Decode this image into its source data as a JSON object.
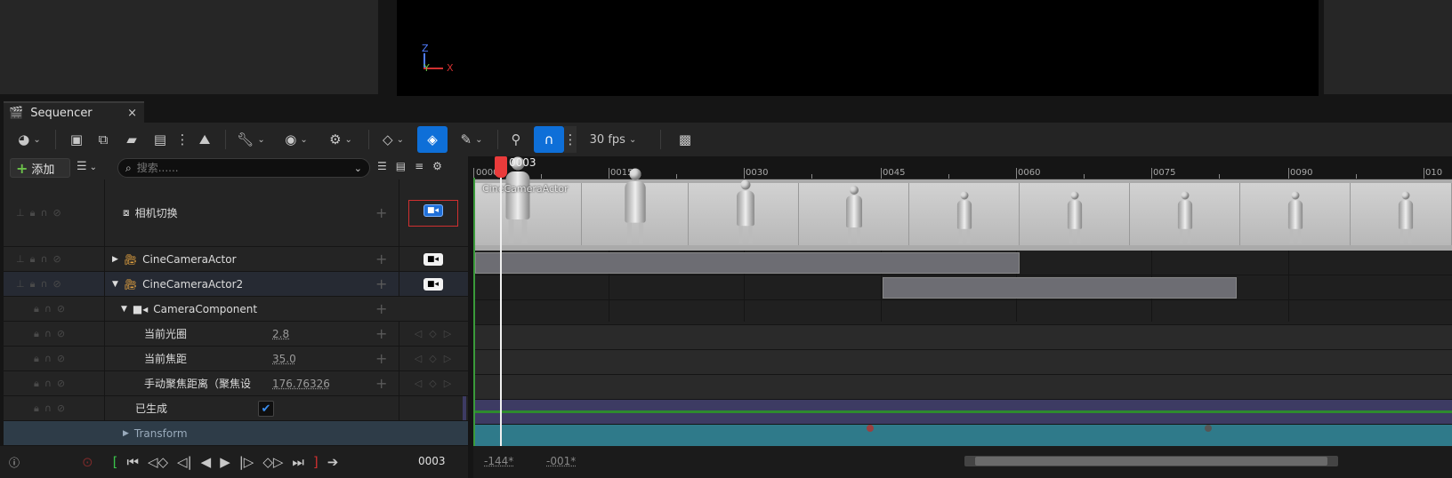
{
  "viewport": {
    "axis_x": "X",
    "axis_y": "Y",
    "axis_z": "Z"
  },
  "tab": {
    "title": "Sequencer",
    "close": "×"
  },
  "toolbar": {
    "fps": "30 fps",
    "icons": [
      "world-icon",
      "save-icon",
      "browse-icon",
      "camera-icon",
      "clapper-icon",
      "more-icon",
      "render-icon",
      "wrench-icon",
      "eye-icon",
      "gear-icon",
      "keyframe-icon",
      "auto-key-icon",
      "pen-icon",
      "marker-icon",
      "magnet-icon",
      "curve-editor-icon"
    ]
  },
  "filter": {
    "add_label": "添加",
    "search_placeholder": "搜索......"
  },
  "tracks": [
    {
      "label": "相机切换"
    },
    {
      "label": "CineCameraActor"
    },
    {
      "label": "CineCameraActor2"
    },
    {
      "label": "CameraComponent"
    },
    {
      "label": "当前光圈",
      "value": "2.8"
    },
    {
      "label": "当前焦距",
      "value": "35.0"
    },
    {
      "label": "手动聚焦距离（聚焦设",
      "value": "176.76326"
    },
    {
      "label": "已生成"
    },
    {
      "label": "Transform"
    }
  ],
  "timeline": {
    "current_frame": "0003",
    "ruler_labels": [
      "0000",
      "0015",
      "0030",
      "0045",
      "0060",
      "0075",
      "0090",
      "010"
    ],
    "cut_track_label": "CineCameraActor"
  },
  "transport": {
    "frame": "0003",
    "range_start": "-144*",
    "range_end": "-001*"
  },
  "colors": {
    "accent": "#0e6fd8",
    "playhead": "#ea3b3b",
    "track_purple": "#3d3b63",
    "track_green": "#2e8a2e",
    "transform_teal": "#2f7a8a"
  }
}
